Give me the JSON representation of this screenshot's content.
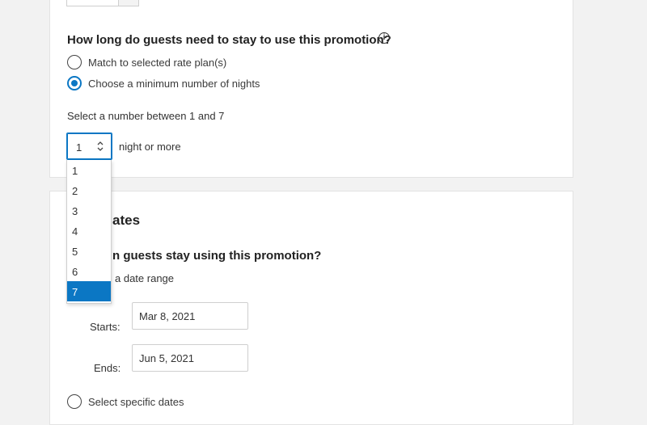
{
  "stay_section": {
    "heading": "How long do guests need to stay to use this promotion?",
    "info_icon": "info-icon",
    "options": [
      {
        "label": "Match to selected rate plan(s)",
        "checked": false
      },
      {
        "label": "Choose a minimum number of nights",
        "checked": true
      }
    ],
    "range_hint": "Select a number between 1 and 7",
    "nights_select": {
      "value": "1",
      "suffix": "night or more",
      "options": [
        "1",
        "2",
        "3",
        "4",
        "5",
        "6",
        "7"
      ],
      "highlighted": "7"
    }
  },
  "dates_section": {
    "heading_visible": "ates",
    "question_visible": "n guests stay using this promotion?",
    "range_option_visible": "a date range",
    "starts_label": "Starts:",
    "starts_value": "Mar 8, 2021",
    "ends_label": "Ends:",
    "ends_value": "Jun 5, 2021",
    "specific_dates_label": "Select specific dates"
  },
  "colors": {
    "accent": "#0b77c4",
    "background": "#f2f2f2",
    "card": "#ffffff"
  }
}
